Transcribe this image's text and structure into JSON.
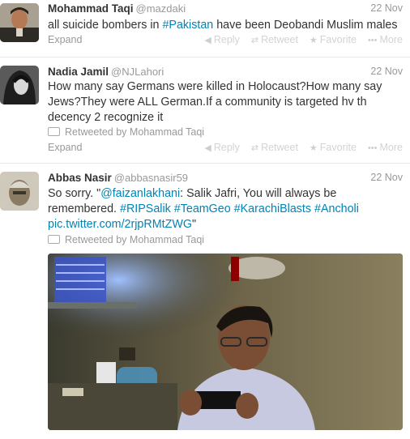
{
  "actions": {
    "expand": "Expand",
    "reply": "Reply",
    "retweet": "Retweet",
    "favorite": "Favorite",
    "more": "More"
  },
  "tweets": [
    {
      "name": "Mohammad Taqi",
      "handle": "@mazdaki",
      "time": "22 Nov",
      "text_parts": [
        "all suicide bombers in ",
        "#Pakistan",
        " have been Deobandi Muslim males"
      ]
    },
    {
      "name": "Nadia Jamil",
      "handle": "@NJLahori",
      "time": "22 Nov",
      "text": "How many say Germans were killed in Holocaust?How many say Jews?They were ALL German.If a community is targeted hv th decency 2 recognize it",
      "retweeted_by": "Retweeted by Mohammad Taqi"
    },
    {
      "name": "Abbas Nasir",
      "handle": "@abbasnasir59",
      "time": "22 Nov",
      "text_parts": [
        "So sorry.  \"",
        "@faizanlakhani",
        ": Salik Jafri, You will always be remembered. ",
        "#RIPSalik",
        " ",
        "#TeamGeo",
        " ",
        "#KarachiBlasts",
        " ",
        "#Ancholi",
        " ",
        "pic.twitter.com/2rjpRMtZWG",
        "\""
      ],
      "retweeted_by": "Retweeted by Mohammad Taqi"
    }
  ],
  "icon_names": [
    "reply-icon",
    "retweet-icon",
    "favorite-icon",
    "more-icon"
  ],
  "colors": {
    "link": "#0084b4",
    "muted": "#999999",
    "text": "#333333"
  }
}
